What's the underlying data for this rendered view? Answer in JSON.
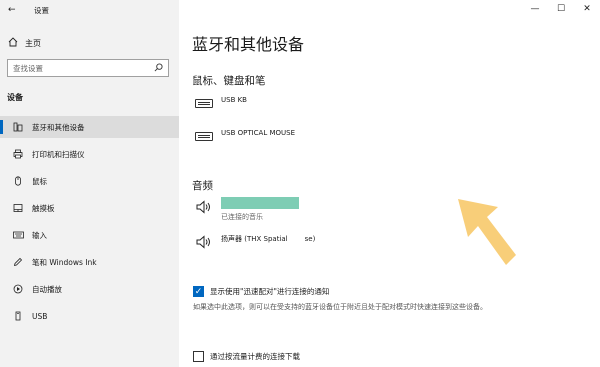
{
  "window": {
    "title": "设置",
    "back_icon": "back-arrow-icon"
  },
  "sidebar": {
    "home_label": "主页",
    "search_placeholder": "查找设置",
    "section_label": "设备",
    "items": [
      {
        "label": "蓝牙和其他设备",
        "icon": "bluetooth-devices-icon",
        "active": true
      },
      {
        "label": "打印机和扫描仪",
        "icon": "printer-icon",
        "active": false
      },
      {
        "label": "鼠标",
        "icon": "mouse-icon",
        "active": false
      },
      {
        "label": "触摸板",
        "icon": "touchpad-icon",
        "active": false
      },
      {
        "label": "输入",
        "icon": "keyboard-icon",
        "active": false
      },
      {
        "label": "笔和 Windows Ink",
        "icon": "pen-icon",
        "active": false
      },
      {
        "label": "自动播放",
        "icon": "autoplay-icon",
        "active": false
      },
      {
        "label": "USB",
        "icon": "usb-icon",
        "active": false
      }
    ]
  },
  "main": {
    "title": "蓝牙和其他设备",
    "mouse_section": {
      "heading": "鼠标、键盘和笔",
      "devices": [
        {
          "name": "USB KB",
          "icon": "keyboard-icon"
        },
        {
          "name": "USB OPTICAL MOUSE",
          "icon": "keyboard-icon"
        }
      ]
    },
    "audio_section": {
      "heading": "音频",
      "devices": [
        {
          "name": "",
          "status": "已连接的音乐",
          "icon": "speaker-icon"
        },
        {
          "name": "扬声器 (THX Spatial",
          "name_suffix": "se)",
          "icon": "speaker-icon"
        }
      ]
    },
    "swift_pair": {
      "label": "显示使用\"迅速配对\"进行连接的通知",
      "checked": true,
      "description": "如果选中此选项，则可以在受支持的蓝牙设备位于附近且处于配对模式时快速连接到这些设备。"
    },
    "metered": {
      "label": "通过按流量计费的连接下载",
      "checked": false
    }
  },
  "colors": {
    "accent": "#0067c0",
    "redacted": "#7ecdb4",
    "arrow": "#f7c96a"
  }
}
